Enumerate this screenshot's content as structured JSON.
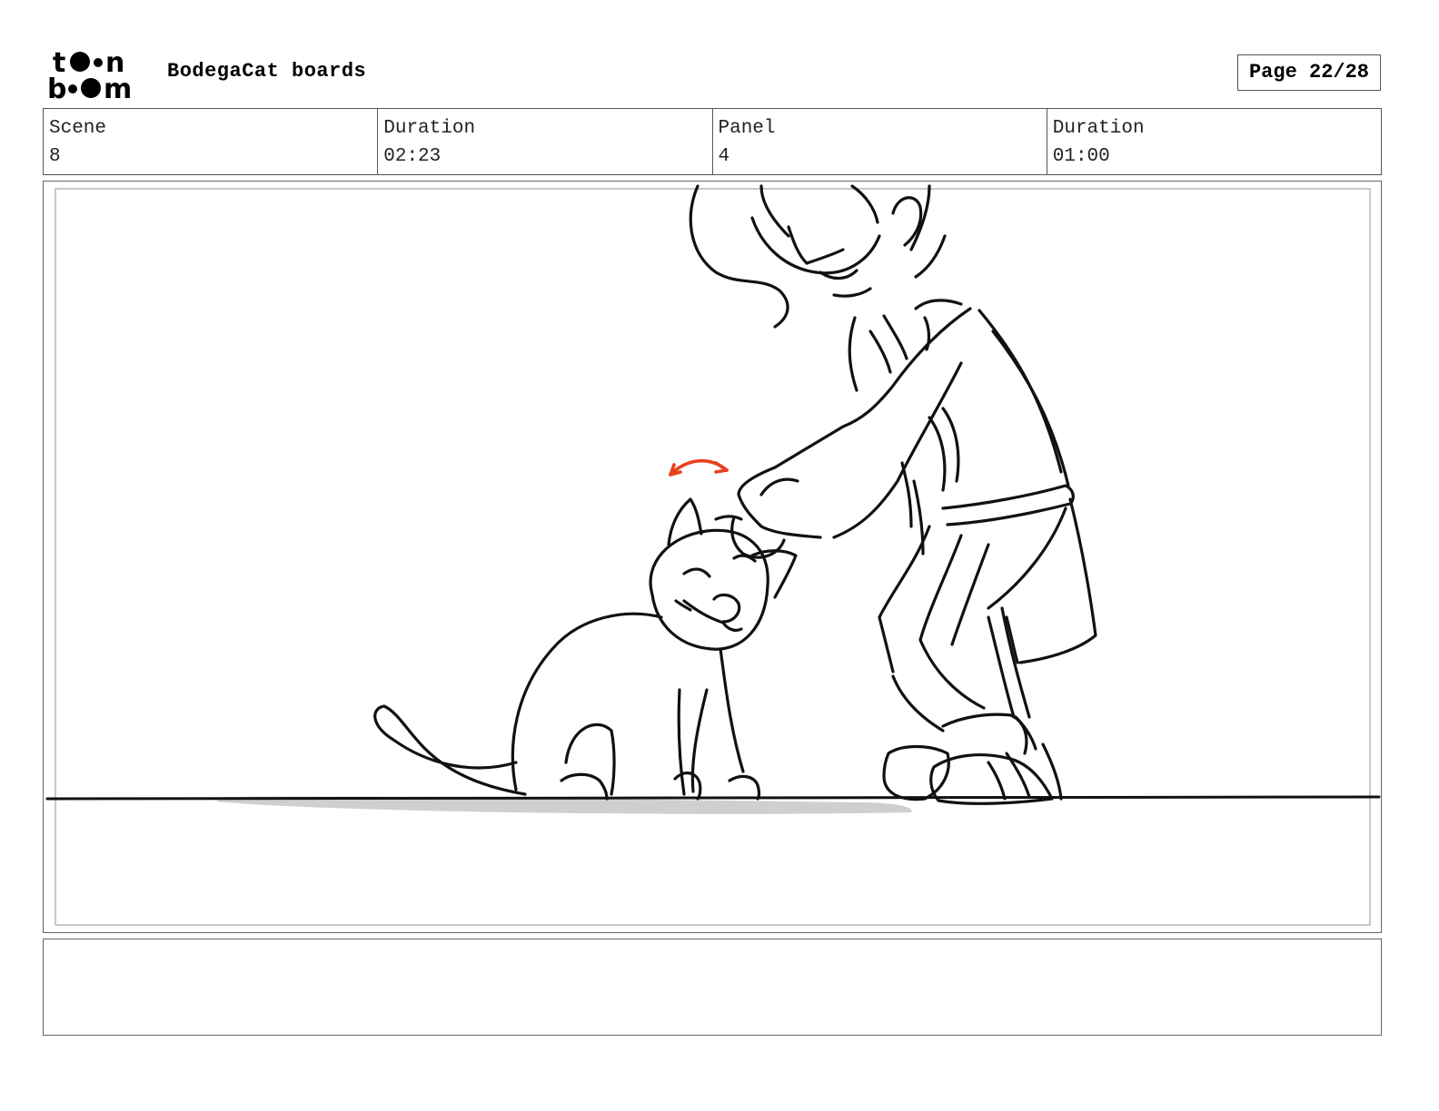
{
  "header": {
    "logo": {
      "line1": "toon",
      "line2": "boom",
      "icon": "toon-boom-logo"
    },
    "project_title": "BodegaCat boards",
    "page_label": "Page 22/28"
  },
  "info": [
    {
      "label": "Scene",
      "value": "8"
    },
    {
      "label": "Duration",
      "value": "02:23"
    },
    {
      "label": "Panel",
      "value": "4"
    },
    {
      "label": "Duration",
      "value": "01:00"
    }
  ],
  "panel": {
    "drawing": "sketch of a person petting a seated cat",
    "line_color": "#111111",
    "accent_color": "#e8401c",
    "shadow_color": "#cfcfcf"
  },
  "notes": {
    "text": ""
  }
}
